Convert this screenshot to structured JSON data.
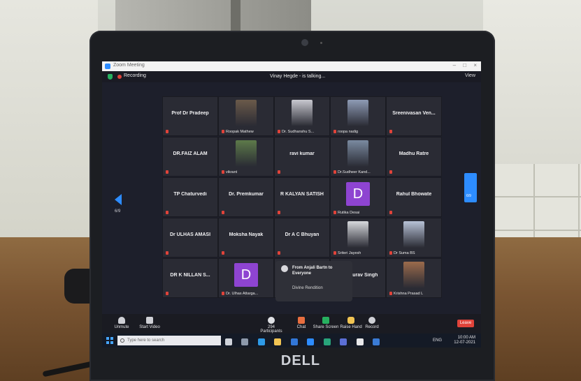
{
  "window": {
    "title": "Zoom Meeting",
    "recording_label": "Recording",
    "talking_status": "Vinay Hegde - is talking...",
    "view_label": "View",
    "controls": [
      "–",
      "□",
      "×"
    ]
  },
  "gallery": {
    "tiles": [
      {
        "name": "Prof Dr Pradeep",
        "type": "name"
      },
      {
        "name": "Roopak Mathew",
        "type": "photo",
        "color": "#6b5a4a"
      },
      {
        "name": "Dr. Sudhanshu S...",
        "type": "photo",
        "color": "#c9c9d0"
      },
      {
        "name": "roopa nadig",
        "type": "photo",
        "color": "#8e9bb5"
      },
      {
        "name": "Sreenivasan  Ven...",
        "type": "name"
      },
      {
        "name": "DR.FAIZ ALAM",
        "type": "name"
      },
      {
        "name": "vikrant",
        "type": "photo",
        "color": "#5d7a4a"
      },
      {
        "name": "ravi kumar",
        "type": "name"
      },
      {
        "name": "Dr.Sudheer Kand...",
        "type": "photo",
        "color": "#7a8aa0"
      },
      {
        "name": "Madhu Ratre",
        "type": "name"
      },
      {
        "name": "TP Chaturvedi",
        "type": "name"
      },
      {
        "name": "Dr. Premkumar",
        "type": "name"
      },
      {
        "name": "R KALYAN SATISH",
        "type": "name"
      },
      {
        "name": "Rutika Desai",
        "type": "letter",
        "letter": "D"
      },
      {
        "name": "Rahul Bhowate",
        "type": "name"
      },
      {
        "name": "Dr ULHAS AMASI",
        "type": "name"
      },
      {
        "name": "Moksha Nayak",
        "type": "name"
      },
      {
        "name": "Dr A C Bhuyan",
        "type": "name"
      },
      {
        "name": "Sriteri Jayesh",
        "type": "photo",
        "color": "#d7d9dd"
      },
      {
        "name": "Dr Suma BS",
        "type": "photo",
        "color": "#b7c2d6"
      },
      {
        "name": "DR K NILLAN S...",
        "type": "name"
      },
      {
        "name": "Dr. Ulhas Attarga...",
        "type": "letter",
        "letter": "D"
      },
      {
        "name": "",
        "type": "empty"
      },
      {
        "name": "Dr. Gaurav Singh",
        "type": "name"
      },
      {
        "name": "Krishna Prasad L",
        "type": "photo",
        "color": "#9b6b4c"
      }
    ],
    "chat_popup": {
      "from": "From Anjali Bartn to Everyone",
      "message": "Divine Rendition"
    },
    "page_left": "6/9",
    "page_right": "6/9"
  },
  "controlbar": {
    "unmute": "Unmute",
    "start_video": "Start Video",
    "participants": "Participants",
    "participants_count": "294",
    "chat": "Chat",
    "share_screen": "Share Screen",
    "raise_hand": "Raise Hand",
    "record": "Record",
    "leave": "Leave"
  },
  "taskbar": {
    "search_placeholder": "Type here to search",
    "language": "ENG",
    "time": "10:00 AM",
    "date": "12-07-2021"
  },
  "laptop": {
    "brand": "DELL"
  }
}
